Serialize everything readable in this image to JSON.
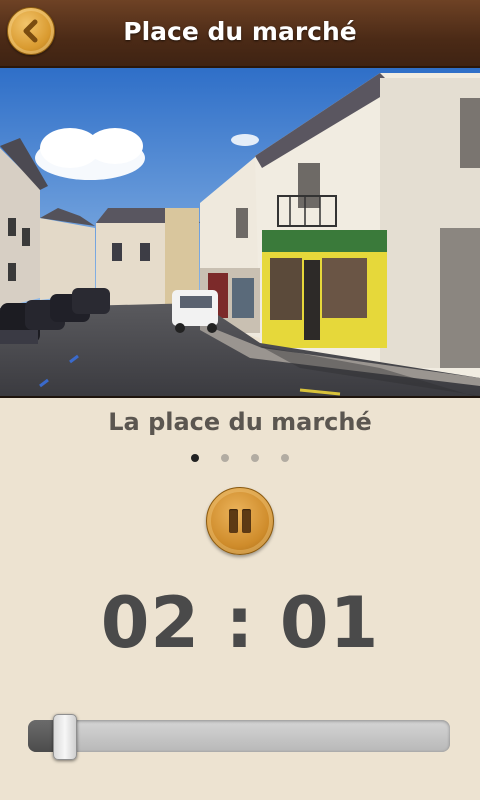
{
  "header": {
    "title": "Place du marché",
    "back_icon": "chevron-left-icon"
  },
  "caption": "La place du marché",
  "pager": {
    "count": 4,
    "active": 0
  },
  "player": {
    "pause_icon": "pause-icon",
    "time": "02 : 01",
    "progress_percent": 8
  },
  "colors": {
    "header_brown": "#4b2a16",
    "gold": "#d99a2f",
    "background": "#ede3d1"
  }
}
